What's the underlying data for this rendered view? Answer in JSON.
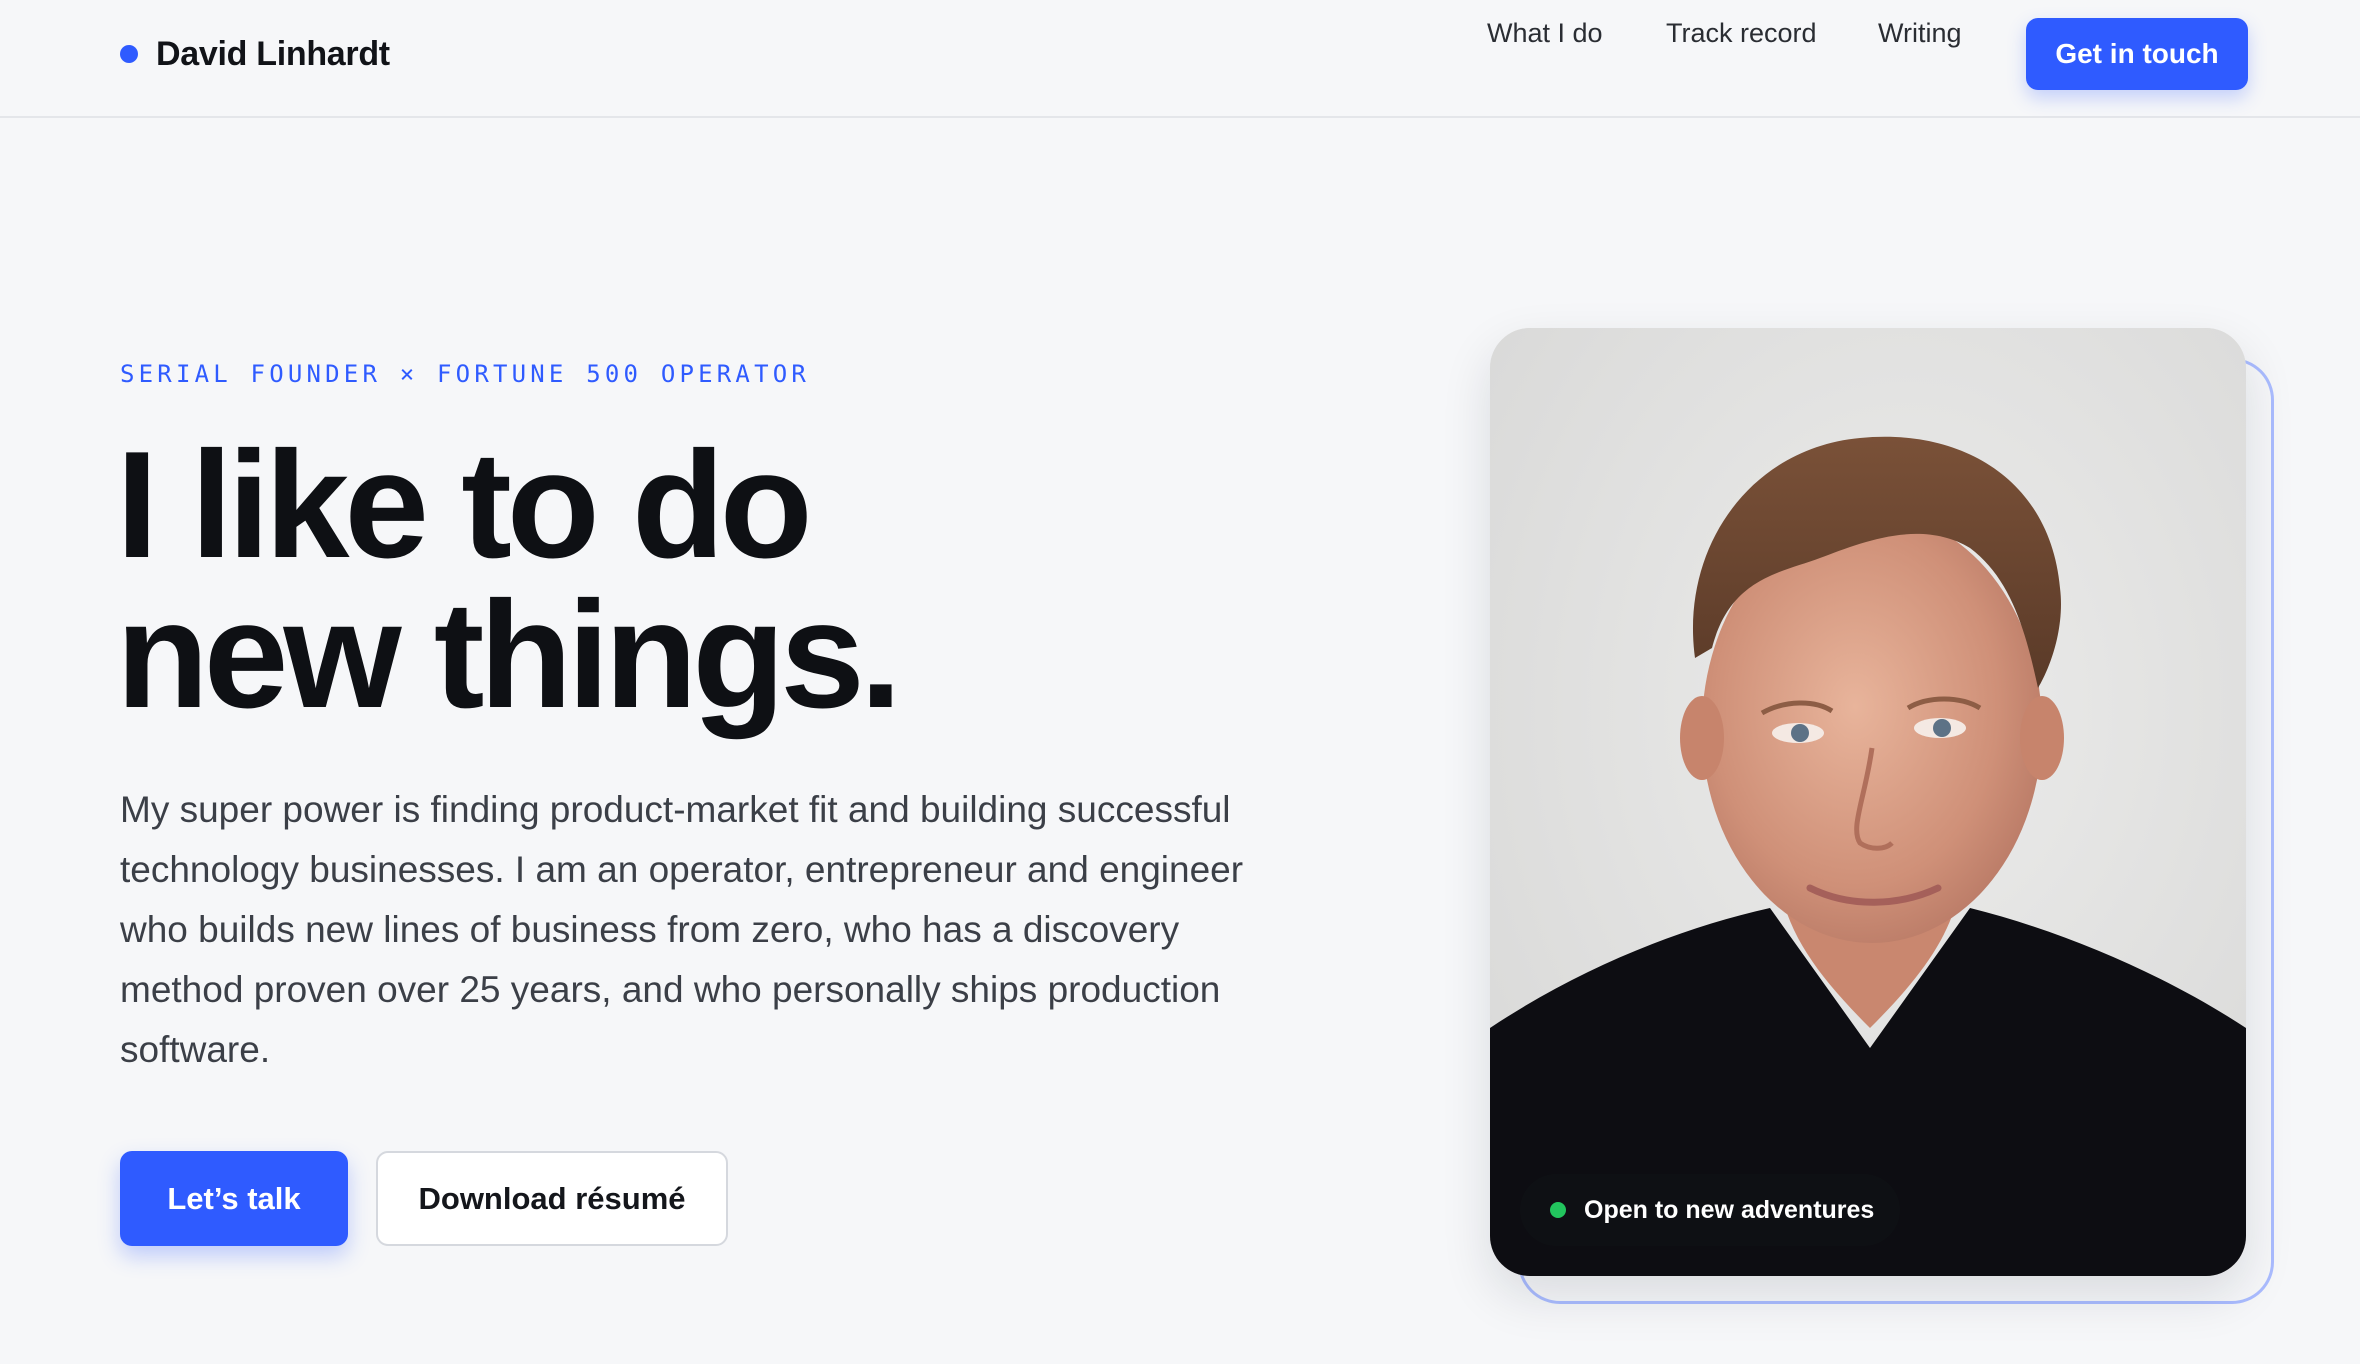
{
  "header": {
    "brand_name": "David Linhardt",
    "nav": [
      "What I do",
      "Track record",
      "Writing"
    ],
    "cta": "Get in touch"
  },
  "hero": {
    "eyebrow": "SERIAL FOUNDER × FORTUNE 500 OPERATOR",
    "headline_line1": "I like to do",
    "headline_line2": "new things.",
    "lede": "My super power is finding product-market fit and building successful technology businesses. I am an operator, entrepreneur and engineer who builds new lines of business from zero, who has a discovery method proven over 25 years, and who personally ships production software.",
    "primary_button": "Let’s talk",
    "secondary_button": "Download résumé"
  },
  "portrait": {
    "status_text": "Open to new adventures",
    "status_color": "#22c55e"
  },
  "colors": {
    "accent": "#2f5bff",
    "background": "#f6f7f9"
  }
}
